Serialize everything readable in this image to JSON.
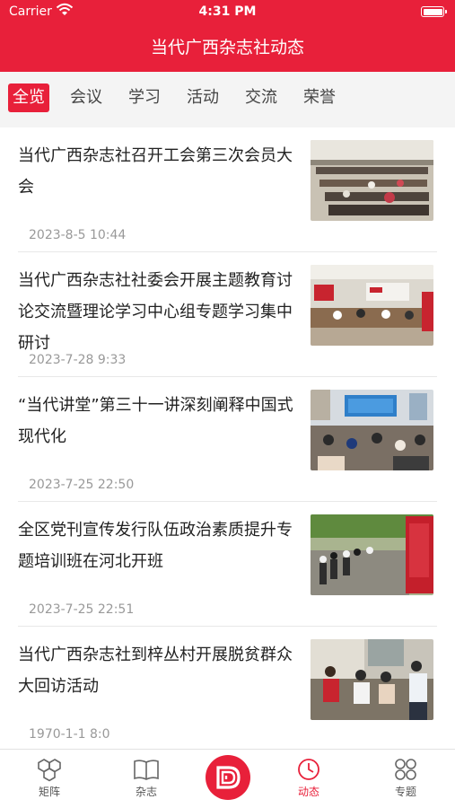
{
  "status_bar": {
    "carrier": "Carrier",
    "time": "4:31 PM"
  },
  "header": {
    "title": "当代广西杂志社动态"
  },
  "tabs": [
    {
      "label": "全览"
    },
    {
      "label": "会议"
    },
    {
      "label": "学习"
    },
    {
      "label": "活动"
    },
    {
      "label": "交流"
    },
    {
      "label": "荣誉"
    }
  ],
  "articles": [
    {
      "title": "当代广西杂志社召开工会第三次会员大会",
      "date": "2023-8-5 10:44"
    },
    {
      "title": "当代广西杂志社社委会开展主题教育讨论交流暨理论学习中心组专题学习集中研讨",
      "date": "2023-7-28 9:33"
    },
    {
      "title": "“当代讲堂”第三十一讲深刻阐释中国式现代化",
      "date": "2023-7-25 22:50"
    },
    {
      "title": "全区党刊宣传发行队伍政治素质提升专题培训班在河北开班",
      "date": "2023-7-25 22:51"
    },
    {
      "title": "当代广西杂志社到梓丛村开展脱贫群众大回访活动",
      "date": "1970-1-1 8:0"
    }
  ],
  "tabbar": {
    "items": [
      {
        "label": "矩阵",
        "icon": "matrix-icon"
      },
      {
        "label": "杂志",
        "icon": "magazine-icon"
      },
      {
        "label": "",
        "icon": "logo-icon"
      },
      {
        "label": "动态",
        "icon": "clock-icon"
      },
      {
        "label": "专题",
        "icon": "grid-icon"
      }
    ]
  },
  "colors": {
    "brand_red": "#e8203a",
    "text_gray": "#999999"
  }
}
